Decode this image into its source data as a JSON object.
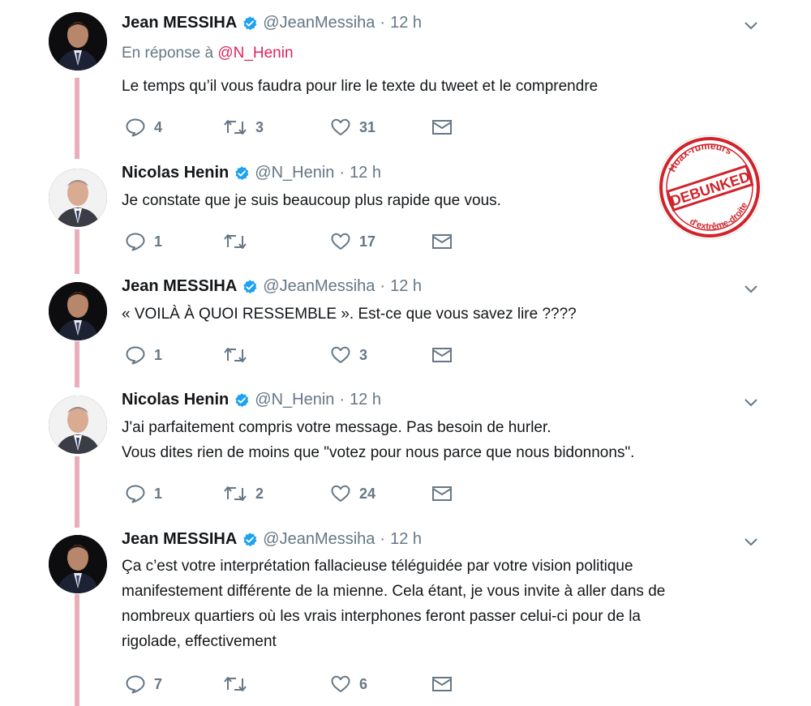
{
  "colors": {
    "thread_line": "#e8aebb",
    "mention": "#e0245e",
    "secondary_text": "#657786",
    "verified": "#1da1f2",
    "stamp": "#d0242b"
  },
  "stamp": {
    "top_text": "Hoax-rumeurs",
    "main_text": "DEBUNKED",
    "bottom_text": "d'extrême-droite"
  },
  "tweets": [
    {
      "name": "Jean MESSIHA",
      "handle": "@JeanMessiha",
      "time": "12 h",
      "reply_prefix": "En réponse à",
      "reply_mention": "@N_Henin",
      "text": "Le temps qu’il vous faudra pour lire le texte du tweet et le comprendre",
      "replies": "4",
      "retweets": "3",
      "likes": "31"
    },
    {
      "name": "Nicolas Henin",
      "handle": "@N_Henin",
      "time": "12 h",
      "text": "Je constate que je suis beaucoup plus rapide que vous.",
      "replies": "1",
      "retweets": "",
      "likes": "17"
    },
    {
      "name": "Jean MESSIHA",
      "handle": "@JeanMessiha",
      "time": "12 h",
      "text": "« VOILÀ À QUOI RESSEMBLE ». Est-ce que vous savez lire ????",
      "replies": "1",
      "retweets": "",
      "likes": "3"
    },
    {
      "name": "Nicolas Henin",
      "handle": "@N_Henin",
      "time": "12 h",
      "text": "J'ai parfaitement compris votre message. Pas besoin de hurler.\nVous dites rien de moins que \"votez pour nous parce que nous bidonnons\".",
      "replies": "1",
      "retweets": "2",
      "likes": "24"
    },
    {
      "name": "Jean MESSIHA",
      "handle": "@JeanMessiha",
      "time": "12 h",
      "text": "Ça c’est votre interprétation fallacieuse téléguidée par votre vision politique\nmanifestement différente de la mienne. Cela étant, je vous invite à aller dans de\nnombreux quartiers où les vrais interphones feront passer celui-ci pour de la\nrigolade, effectivement",
      "replies": "7",
      "retweets": "",
      "likes": "6"
    }
  ]
}
